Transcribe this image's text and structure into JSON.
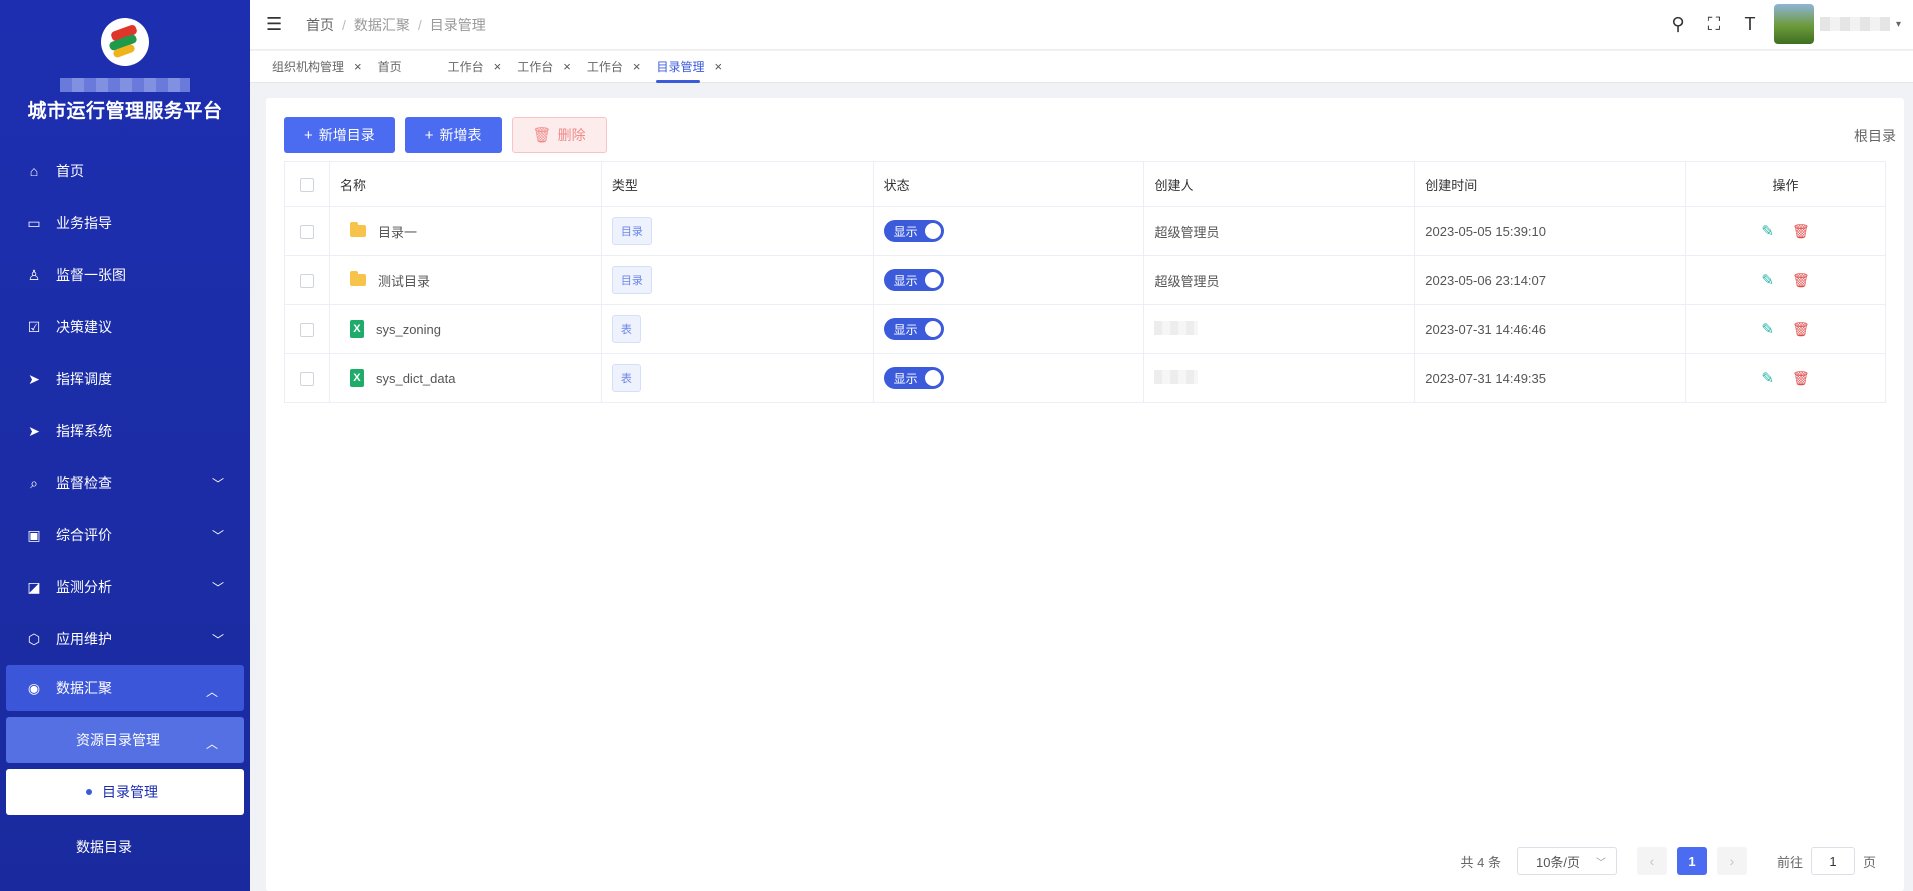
{
  "sidebar": {
    "title": "城市运行管理服务平台",
    "items": [
      {
        "label": "首页",
        "icon": "home-icon"
      },
      {
        "label": "业务指导",
        "icon": "book-icon"
      },
      {
        "label": "监督一张图",
        "icon": "user-icon"
      },
      {
        "label": "决策建议",
        "icon": "edit-check-icon"
      },
      {
        "label": "指挥调度",
        "icon": "send-icon"
      },
      {
        "label": "指挥系统",
        "icon": "send-icon"
      },
      {
        "label": "监督检查",
        "icon": "search-icon"
      },
      {
        "label": "综合评价",
        "icon": "monitor-icon"
      },
      {
        "label": "监测分析",
        "icon": "chart-icon"
      },
      {
        "label": "应用维护",
        "icon": "settings-icon"
      },
      {
        "label": "数据汇聚",
        "icon": "data-icon"
      }
    ],
    "submenu": {
      "label": "资源目录管理",
      "children": [
        "目录管理",
        "数据目录"
      ]
    }
  },
  "header": {
    "breadcrumb": [
      "首页",
      "数据汇聚",
      "目录管理"
    ]
  },
  "tabs": [
    {
      "label": "组织机构管理",
      "closable": true
    },
    {
      "label": "首页",
      "closable": false
    },
    {
      "label": "工作台",
      "closable": true
    },
    {
      "label": "工作台",
      "closable": true
    },
    {
      "label": "工作台",
      "closable": true
    },
    {
      "label": "目录管理",
      "closable": true,
      "active": true
    }
  ],
  "toolbar": {
    "add_dir": "新增目录",
    "add_table": "新增表",
    "delete": "删除",
    "root": "根目录"
  },
  "table": {
    "columns": [
      "名称",
      "类型",
      "状态",
      "创建人",
      "创建时间",
      "操作"
    ],
    "rows": [
      {
        "name": "目录一",
        "kind": "folder",
        "type": "目录",
        "status": "显示",
        "creator": "超级管理员",
        "created": "2023-05-05 15:39:10"
      },
      {
        "name": "测试目录",
        "kind": "folder",
        "type": "目录",
        "status": "显示",
        "creator": "超级管理员",
        "created": "2023-05-06 23:14:07"
      },
      {
        "name": "sys_zoning",
        "kind": "table",
        "type": "表",
        "status": "显示",
        "creator": "",
        "created": "2023-07-31 14:46:46"
      },
      {
        "name": "sys_dict_data",
        "kind": "table",
        "type": "表",
        "status": "显示",
        "creator": "",
        "created": "2023-07-31 14:49:35"
      }
    ]
  },
  "pager": {
    "total": "共 4 条",
    "page_size": "10条/页",
    "current": "1",
    "goto_label": "前往",
    "goto_value": "1",
    "page_suffix": "页"
  },
  "colors": {
    "primary": "#4b6cf0",
    "sidebar": "#1d2fb0",
    "danger": "#e04b4b",
    "edit": "#22b5a3"
  }
}
